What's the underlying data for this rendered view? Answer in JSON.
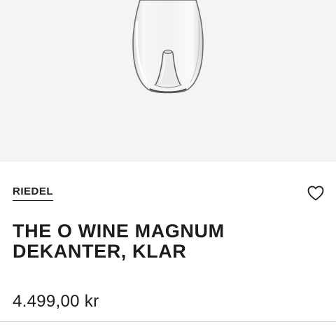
{
  "product": {
    "brand": "RIEDEL",
    "title": "THE O WINE MAGNUM DEKANTER, KLAR",
    "price": "4.499,00 kr",
    "image_icon": "decanter-image",
    "favorite_icon": "heart-outline-icon"
  },
  "colors": {
    "image_background": "#f4f4f4",
    "text": "#1c1c1c",
    "divider": "#d6d6d6"
  }
}
